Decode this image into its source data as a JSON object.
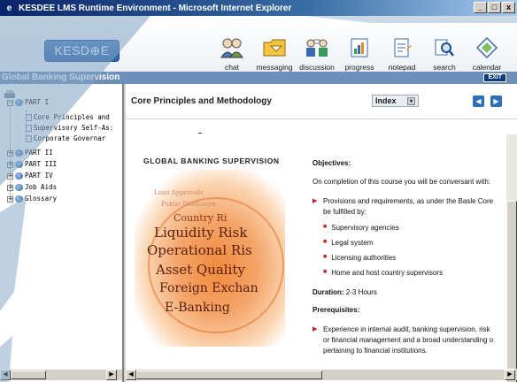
{
  "window": {
    "title": "KESDEE LMS Runtime Environment - Microsoft Internet Explorer",
    "controls": [
      "_",
      "□",
      "x"
    ]
  },
  "header": {
    "logo": "KESD⊕E",
    "toolbar": [
      {
        "label": "chat",
        "icon": "chat-icon"
      },
      {
        "label": "messaging",
        "icon": "messaging-icon"
      },
      {
        "label": "discussion",
        "icon": "discussion-icon"
      },
      {
        "label": "progress",
        "icon": "progress-icon"
      },
      {
        "label": "notepad",
        "icon": "notepad-icon"
      },
      {
        "label": "search",
        "icon": "search-icon"
      },
      {
        "label": "calendar",
        "icon": "calendar-icon"
      }
    ]
  },
  "course_bar": {
    "title": "Global Banking Supervision",
    "exit": "EXIT"
  },
  "tree": {
    "items": [
      {
        "label": "PART I",
        "type": "part",
        "expanded": true
      },
      {
        "label": "Core Principles and",
        "type": "page"
      },
      {
        "label": "Supervisory Self-As:",
        "type": "page"
      },
      {
        "label": "Corporate Governar",
        "type": "page"
      },
      {
        "label": "PART II",
        "type": "part"
      },
      {
        "label": "PART III",
        "type": "part"
      },
      {
        "label": "PART IV",
        "type": "part"
      },
      {
        "label": "Job Aids",
        "type": "part"
      },
      {
        "label": "Glossary",
        "type": "part"
      }
    ]
  },
  "content": {
    "page_title": "Core Principles and Methodology",
    "index_label": "Index",
    "image_heading": "GLOBAL BANKING SUPERVISION",
    "image_words": [
      "Loan Approvals",
      "Public Disclosure",
      "Country Ri",
      "Liquidity Risk",
      "Operational Ris",
      "Asset Quality",
      "Foreign Exchan",
      "E-Banking"
    ],
    "objectives_heading": "Objectives:",
    "objectives_intro": "On completion of this course you will be conversant with:",
    "objective_point_1": "Provisions and requirements, as under the Basle Core",
    "objective_point_1b": "be fulfilled by:",
    "sub_points": [
      "Supervisory agencies",
      "Legal system",
      "Licensing authorities",
      "Home and host country supervisors"
    ],
    "duration_label": "Duration:",
    "duration_value": "2-3 Hours",
    "prerequisites_heading": "Prerequisites:",
    "prereq_1": "Experience in internal audit, banking supervision, risk",
    "prereq_1b": "or financial management and a broad understanding o",
    "prereq_1c": "pertaining to financial institutions."
  },
  "colors": {
    "title_bar": "#0a246a",
    "course_bar": "#6e90b8",
    "bullet": "#c21d1d",
    "nav_button": "#2f6fb8"
  }
}
